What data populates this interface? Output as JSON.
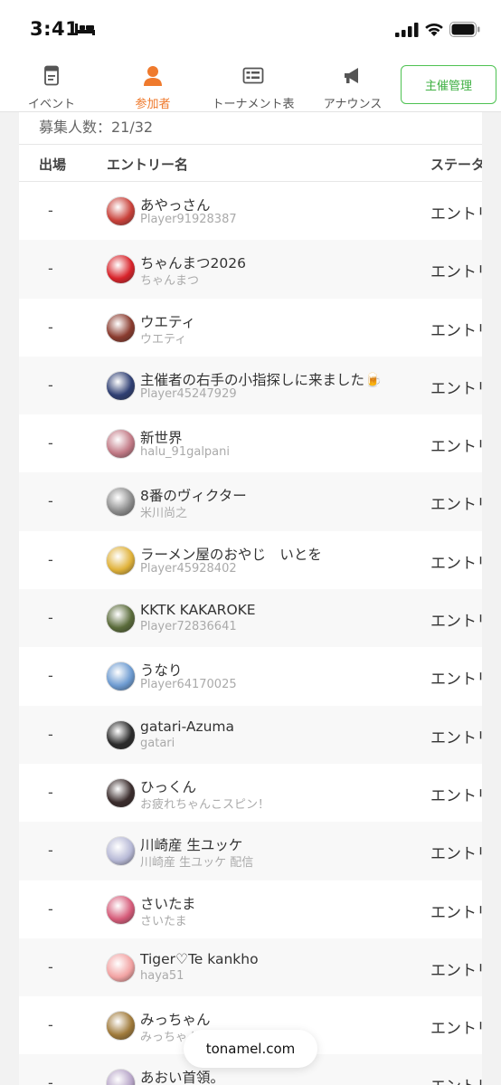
{
  "status_bar": {
    "time": "3:41"
  },
  "tabs": [
    {
      "label": "イベント",
      "icon": "document-icon",
      "active": false
    },
    {
      "label": "参加者",
      "icon": "person-icon",
      "active": true
    },
    {
      "label": "トーナメント表",
      "icon": "bracket-icon",
      "active": false
    },
    {
      "label": "アナウンス",
      "icon": "megaphone-icon",
      "active": false
    }
  ],
  "manage_button": "主催管理",
  "recruit_count": "募集人数：21/32",
  "table": {
    "headers": {
      "play": "出場",
      "entry": "エントリー名",
      "status": "ステータス"
    },
    "rows": [
      {
        "play": "-",
        "name": "あやっさん",
        "sub": "Player91928387",
        "status": "エントリー",
        "avatar_color": "#c9413a"
      },
      {
        "play": "-",
        "name": "ちゃんまつ2026",
        "sub": "ちゃんまつ",
        "status": "エントリー",
        "avatar_color": "#d8232a"
      },
      {
        "play": "-",
        "name": "ウエティ",
        "sub": "ウエティ",
        "status": "エントリー",
        "avatar_color": "#8a3b2e"
      },
      {
        "play": "-",
        "name": "主催者の右手の小指探しに来ました🍺",
        "sub": "Player45247929",
        "status": "エントリー",
        "avatar_color": "#2f3f73"
      },
      {
        "play": "-",
        "name": "新世界",
        "sub": "halu_91galpani",
        "status": "エントリー",
        "avatar_color": "#c27a86"
      },
      {
        "play": "-",
        "name": "8番のヴィクター",
        "sub": "米川尚之",
        "status": "エントリー",
        "avatar_color": "#8d8d8d"
      },
      {
        "play": "-",
        "name": "ラーメン屋のおやじ　いとを",
        "sub": "Player45928402",
        "status": "エントリー",
        "avatar_color": "#e0b23a"
      },
      {
        "play": "-",
        "name": "KKTK KAKAROKE",
        "sub": "Player72836641",
        "status": "エントリー",
        "avatar_color": "#5a6b3a"
      },
      {
        "play": "-",
        "name": "うなり",
        "sub": "Player64170025",
        "status": "エントリー",
        "avatar_color": "#6d9bd1"
      },
      {
        "play": "-",
        "name": "gatari-Azuma",
        "sub": "gatari",
        "status": "エントリー",
        "avatar_color": "#2b2b2b"
      },
      {
        "play": "-",
        "name": "ひっくん",
        "sub": "お疲れちゃんこスピン！",
        "status": "エントリー",
        "avatar_color": "#3a2c2c"
      },
      {
        "play": "-",
        "name": "川崎産 生ユッケ",
        "sub": "川崎産 生ユッケ 配信",
        "status": "エントリー",
        "avatar_color": "#b7b9d6"
      },
      {
        "play": "-",
        "name": "さいたま",
        "sub": "さいたま",
        "status": "エントリー",
        "avatar_color": "#d65c7a"
      },
      {
        "play": "-",
        "name": "Tiger♡Te kankho",
        "sub": "haya51",
        "status": "エントリー",
        "avatar_color": "#f2a3a3"
      },
      {
        "play": "-",
        "name": "みっちゃん",
        "sub": "みっちゃん",
        "status": "エントリー",
        "avatar_color": "#a07a3a"
      },
      {
        "play": "-",
        "name": "あおい首領。",
        "sub": "",
        "status": "エントリー",
        "avatar_color": "#b8a6c9"
      }
    ]
  },
  "site_pill": "tonamel.com"
}
